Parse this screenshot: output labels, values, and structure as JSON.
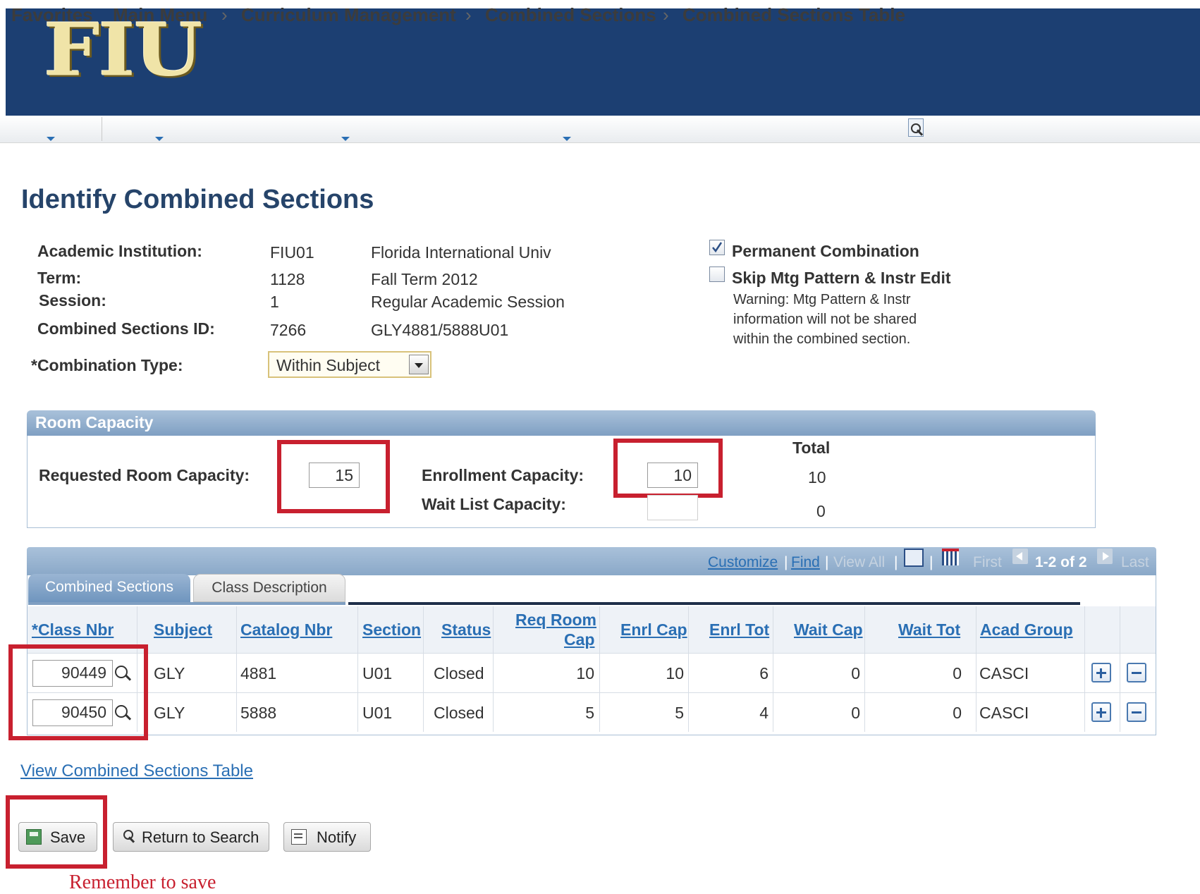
{
  "header": {
    "logo_text": "FIU"
  },
  "nav": {
    "favorites": "Favorites",
    "main_menu": "Main Menu",
    "crumbs": [
      "Curriculum Management",
      "Combined Sections",
      "Combined Sections Table"
    ],
    "separator": "›"
  },
  "page": {
    "title": "Identify Combined Sections",
    "fields": {
      "institution_label": "Academic Institution:",
      "institution_code": "FIU01",
      "institution_name": "Florida International Univ",
      "term_label": "Term:",
      "term_code": "1128",
      "term_name": "Fall Term 2012",
      "session_label": "Session:",
      "session_code": "1",
      "session_name": "Regular Academic Session",
      "combined_id_label": "Combined Sections ID:",
      "combined_id": "7266",
      "combined_name": "GLY4881/5888U01",
      "combination_type_label": "*Combination Type:",
      "combination_type_value": "Within Subject"
    },
    "options": {
      "permanent_label": "Permanent Combination",
      "permanent_checked": true,
      "skip_label": "Skip Mtg Pattern & Instr Edit",
      "skip_checked": false,
      "warning_lines": [
        "Warning: Mtg Pattern & Instr",
        "information will not be shared",
        "within the combined section."
      ]
    }
  },
  "room_capacity": {
    "title": "Room Capacity",
    "requested_label": "Requested Room Capacity:",
    "requested_value": "15",
    "enrollment_label": "Enrollment Capacity:",
    "enrollment_value": "10",
    "waitlist_label": "Wait List Capacity:",
    "waitlist_value": "",
    "total_header": "Total",
    "total_enrollment": "10",
    "total_waitlist": "0"
  },
  "grid": {
    "nav": {
      "customize": "Customize",
      "find": "Find",
      "view_all": "View All",
      "first": "First",
      "range": "1-2 of 2",
      "last": "Last"
    },
    "tabs": [
      "Combined Sections",
      "Class Description"
    ],
    "columns": [
      "*Class Nbr",
      "Subject",
      "Catalog Nbr",
      "Section",
      "Status",
      "Req Room",
      "Cap",
      "Enrl Cap",
      "Enrl Tot",
      "Wait Cap",
      "Wait Tot",
      "Acad Group"
    ],
    "rows": [
      {
        "class_nbr": "90449",
        "subject": "GLY",
        "catalog": "4881",
        "section": "U01",
        "status": "Closed",
        "req_room_cap": "10",
        "enrl_cap": "10",
        "enrl_tot": "6",
        "wait_cap": "0",
        "wait_tot": "0",
        "acad_group": "CASCI"
      },
      {
        "class_nbr": "90450",
        "subject": "GLY",
        "catalog": "5888",
        "section": "U01",
        "status": "Closed",
        "req_room_cap": "5",
        "enrl_cap": "5",
        "enrl_tot": "4",
        "wait_cap": "0",
        "wait_tot": "0",
        "acad_group": "CASCI"
      }
    ]
  },
  "links": {
    "view_table": "View Combined Sections Table"
  },
  "buttons": {
    "save": "Save",
    "return": "Return to Search",
    "notify": "Notify"
  },
  "annotation": {
    "remember": "Remember to save"
  },
  "colors": {
    "banner": "#1c3f72",
    "highlight": "#c8202f",
    "link": "#2a6fb4",
    "title": "#26446a"
  }
}
